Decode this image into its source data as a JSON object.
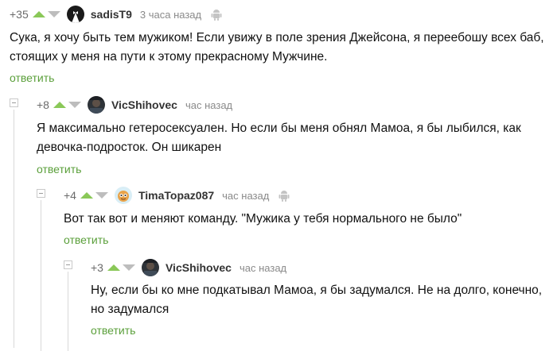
{
  "comments": [
    {
      "rating": "+35",
      "author": "sadisT9",
      "time": "3 часа назад",
      "text": "Сука, я хочу быть тем мужиком! Если увижу в поле зрения Джейсона, я переебошу всех баб, стоящих у меня на пути к этому прекрасному Мужчине.",
      "reply": "ответить",
      "avatar_icon": "tuxedo-avatar",
      "device_icon": "android-icon"
    },
    {
      "rating": "+8",
      "author": "VicShihovec",
      "time": "час назад",
      "text": "Я максимально гетеросексуален. Но если бы меня обнял Мамоа, я бы лыбился, как девочка-подросток. Он шикарен",
      "reply": "ответить",
      "avatar_icon": "photo-avatar"
    },
    {
      "rating": "+4",
      "author": "TimaTopaz087",
      "time": "час назад",
      "text": "Вот так вот и меняют команду. \"Мужика у тебя нормального не было\"",
      "reply": "ответить",
      "avatar_icon": "cartoon-avatar",
      "device_icon": "android-icon"
    },
    {
      "rating": "+3",
      "author": "VicShihovec",
      "time": "час назад",
      "text": "Ну, если бы ко мне подкатывал Мамоа, я бы задумался. Не на долго, конечно, но задумался",
      "reply": "ответить",
      "avatar_icon": "photo-avatar"
    }
  ],
  "colors": {
    "upvote": "#8ac858",
    "downvote": "#bdbdbd",
    "reply_link": "#5a9f3a",
    "muted": "#8a8a8a"
  }
}
